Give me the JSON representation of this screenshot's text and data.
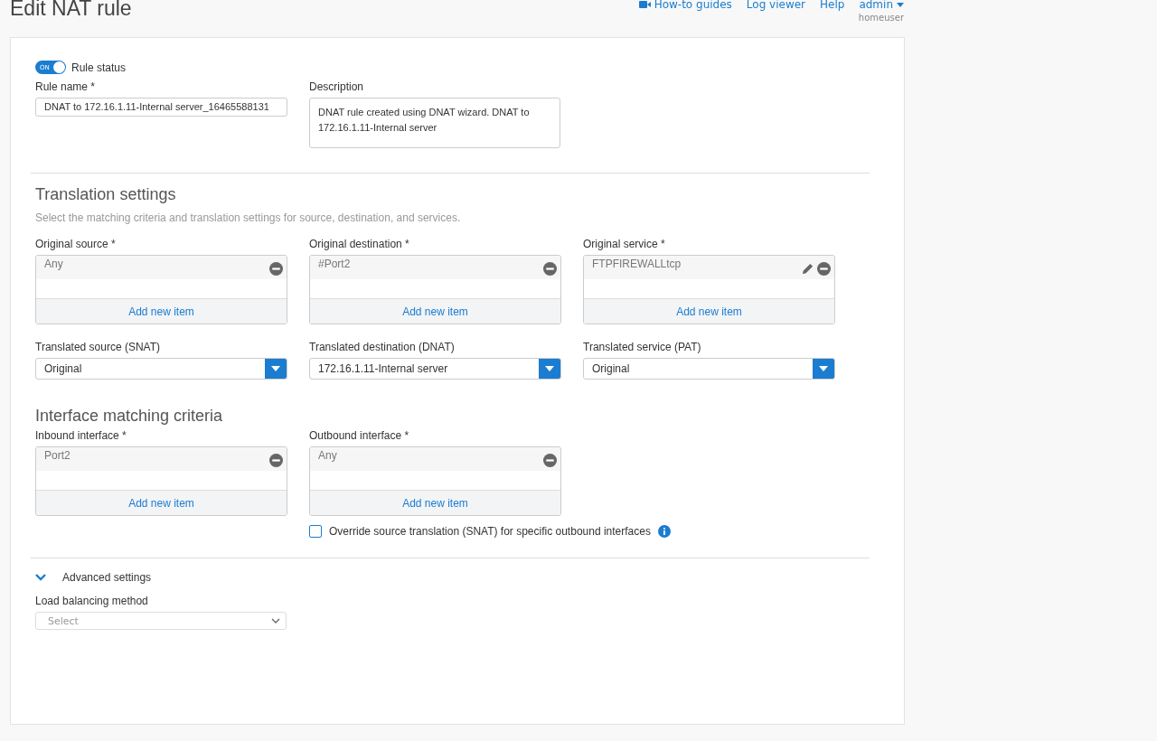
{
  "header": {
    "title": "Edit NAT rule",
    "links": [
      {
        "label": "How-to guides",
        "kind": "video"
      },
      {
        "label": "Log viewer",
        "kind": "plain"
      },
      {
        "label": "Help",
        "kind": "plain"
      },
      {
        "label": "admin",
        "kind": "menu"
      }
    ],
    "user": "homeuser"
  },
  "rule_status": {
    "label": "Rule status",
    "on": true,
    "toggle_text": "ON"
  },
  "rule_name": {
    "label": "Rule name *",
    "value": "DNAT to 172.16.1.11-Internal server_16465588131"
  },
  "description": {
    "label": "Description",
    "value": "DNAT rule created using DNAT wizard. DNAT to 172.16.1.11-Internal server"
  },
  "translation": {
    "title": "Translation settings",
    "subtitle": "Select the matching criteria and translation settings for source, destination, and services.",
    "pickers": [
      {
        "label": "Original source *",
        "items": [
          {
            "text": "Any",
            "editable": false
          }
        ],
        "add_label": "Add new item"
      },
      {
        "label": "Original destination *",
        "items": [
          {
            "text": "#Port2",
            "editable": false
          }
        ],
        "add_label": "Add new item"
      },
      {
        "label": "Original service *",
        "items": [
          {
            "text": "FTPFIREWALLtcp",
            "editable": true
          }
        ],
        "add_label": "Add new item"
      }
    ],
    "selects": [
      {
        "label": "Translated source (SNAT)",
        "value": "Original"
      },
      {
        "label": "Translated destination (DNAT)",
        "value": "172.16.1.11-Internal server"
      },
      {
        "label": "Translated service (PAT)",
        "value": "Original"
      }
    ]
  },
  "interface": {
    "title": "Interface matching criteria",
    "pickers": [
      {
        "label": "Inbound interface *",
        "items": [
          {
            "text": "Port2",
            "editable": false
          }
        ],
        "add_label": "Add new item"
      },
      {
        "label": "Outbound interface *",
        "items": [
          {
            "text": "Any",
            "editable": false
          }
        ],
        "add_label": "Add new item"
      }
    ],
    "override": {
      "label": "Override source translation (SNAT) for specific outbound interfaces",
      "checked": false
    }
  },
  "advanced": {
    "label": "Advanced settings",
    "expanded": true,
    "load_balancing": {
      "label": "Load balancing method",
      "placeholder": "Select"
    }
  }
}
